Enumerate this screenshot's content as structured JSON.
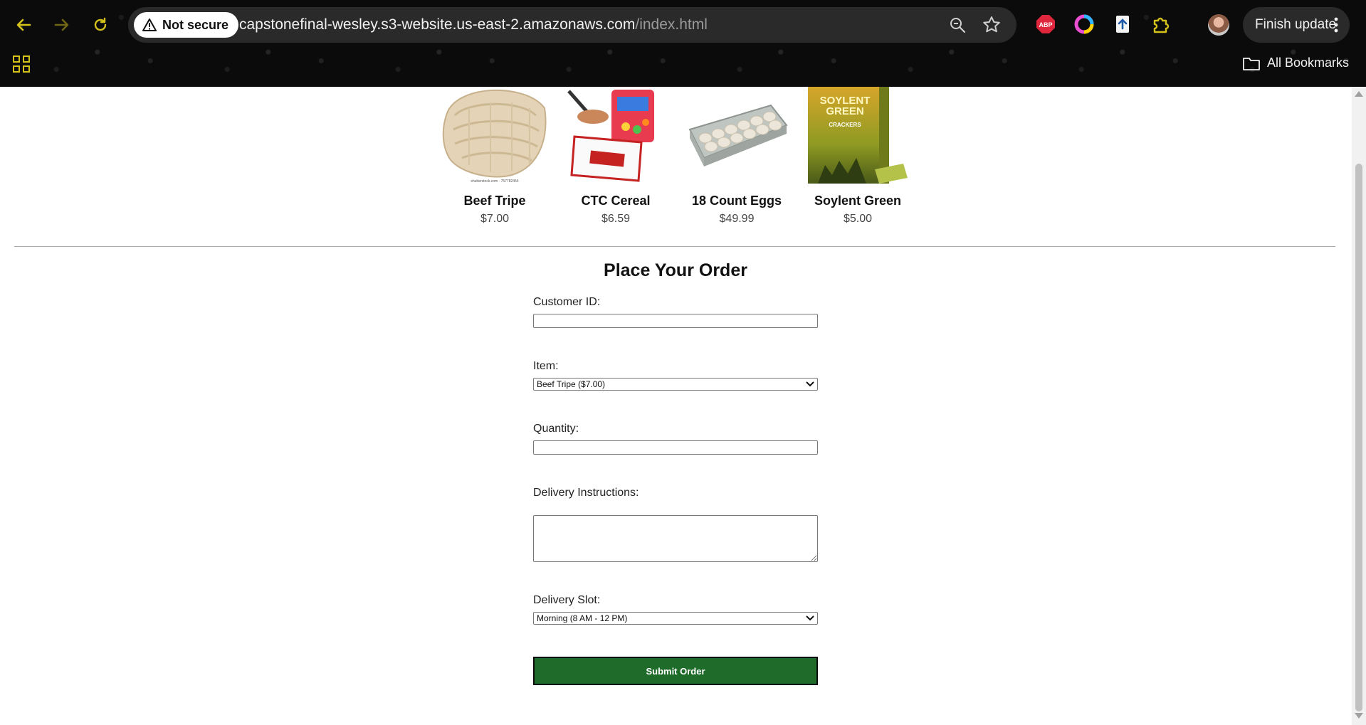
{
  "browser": {
    "security_label": "Not secure",
    "url_host": "capstonefinal-wesley.s3-website.us-east-2.amazonaws.com",
    "url_path": "/index.html",
    "finish_update_label": "Finish update",
    "all_bookmarks_label": "All Bookmarks",
    "extensions": [
      "adblock-plus-icon",
      "color-picker-icon",
      "upload-extension-icon",
      "puzzle-extension-icon"
    ],
    "abp_text": "ABP",
    "accent_color": "#d4c21a"
  },
  "products": [
    {
      "name": "Beef Tripe",
      "price": "$7.00",
      "caption": "shutterstock.com · 757782454"
    },
    {
      "name": "CTC Cereal",
      "price": "$6.59"
    },
    {
      "name": "18 Count Eggs",
      "price": "$49.99"
    },
    {
      "name": "Soylent Green",
      "price": "$5.00",
      "box_text": "SOYLENT GREEN",
      "box_sub": "CRACKERS"
    }
  ],
  "order_form": {
    "title": "Place Your Order",
    "customer_id_label": "Customer ID:",
    "customer_id_value": "",
    "item_label": "Item:",
    "item_selected": "Beef Tripe ($7.00)",
    "quantity_label": "Quantity:",
    "quantity_value": "",
    "instructions_label": "Delivery Instructions:",
    "instructions_value": "",
    "slot_label": "Delivery Slot:",
    "slot_selected": "Morning (8 AM - 12 PM)",
    "submit_label": "Submit Order",
    "submit_color": "#1f6b2a"
  }
}
